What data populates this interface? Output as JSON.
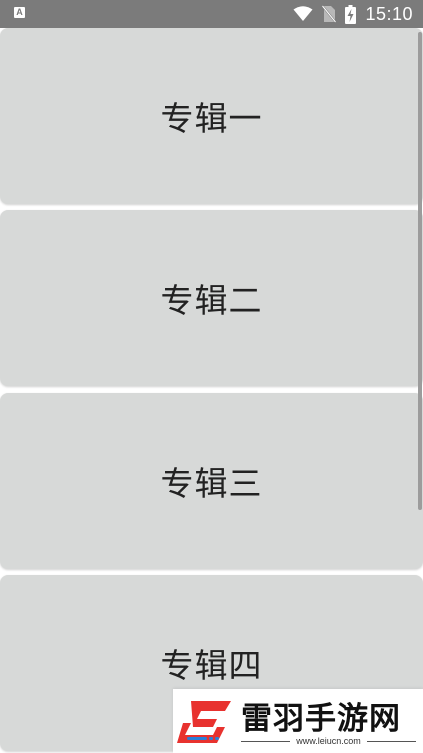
{
  "status_bar": {
    "left_icon": "A",
    "time": "15:10",
    "icons": [
      "notification-a-icon",
      "wifi-icon",
      "no-sim-icon",
      "battery-charging-icon"
    ]
  },
  "albums": [
    {
      "label": "专辑一"
    },
    {
      "label": "专辑二"
    },
    {
      "label": "专辑三"
    },
    {
      "label": "专辑四"
    }
  ],
  "watermark": {
    "title": "雷羽手游网",
    "url": "www.leiucn.com",
    "colors": {
      "logo_red": "#e8322f",
      "logo_blue": "#2b7fd8"
    }
  },
  "colors": {
    "status_bar_bg": "#7b7b7b",
    "card_bg": "#d7d9d8",
    "card_text": "#222222"
  }
}
